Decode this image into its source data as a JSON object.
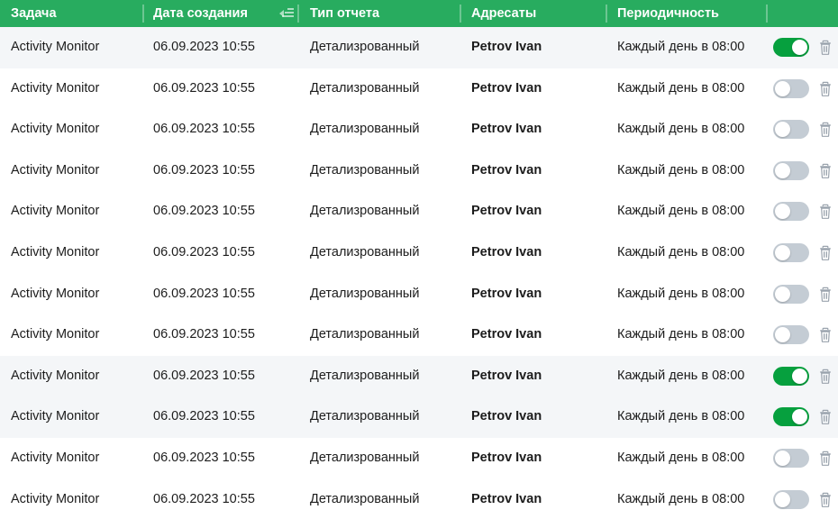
{
  "table": {
    "columns": [
      {
        "key": "task",
        "label": "Задача"
      },
      {
        "key": "date",
        "label": "Дата создания",
        "sort_icon": "sort-descending-icon"
      },
      {
        "key": "type",
        "label": "Тип отчета"
      },
      {
        "key": "addr",
        "label": "Адресаты"
      },
      {
        "key": "period",
        "label": "Периодичность"
      },
      {
        "key": "ctrl",
        "label": ""
      }
    ],
    "rows": [
      {
        "task": "Activity Monitor",
        "date": "06.09.2023 10:55",
        "type": "Детализрованный",
        "addr": "Petrov Ivan",
        "period": "Каждый день в 08:00",
        "enabled": true,
        "delete_icon": "trash-icon"
      },
      {
        "task": "Activity Monitor",
        "date": "06.09.2023 10:55",
        "type": "Детализрованный",
        "addr": "Petrov Ivan",
        "period": "Каждый день в 08:00",
        "enabled": false,
        "delete_icon": "trash-icon"
      },
      {
        "task": "Activity Monitor",
        "date": "06.09.2023 10:55",
        "type": "Детализрованный",
        "addr": "Petrov Ivan",
        "period": "Каждый день в 08:00",
        "enabled": false,
        "delete_icon": "trash-icon"
      },
      {
        "task": "Activity Monitor",
        "date": "06.09.2023 10:55",
        "type": "Детализрованный",
        "addr": "Petrov Ivan",
        "period": "Каждый день в 08:00",
        "enabled": false,
        "delete_icon": "trash-icon"
      },
      {
        "task": "Activity Monitor",
        "date": "06.09.2023 10:55",
        "type": "Детализрованный",
        "addr": "Petrov Ivan",
        "period": "Каждый день в 08:00",
        "enabled": false,
        "delete_icon": "trash-icon"
      },
      {
        "task": "Activity Monitor",
        "date": "06.09.2023 10:55",
        "type": "Детализрованный",
        "addr": "Petrov Ivan",
        "period": "Каждый день в 08:00",
        "enabled": false,
        "delete_icon": "trash-icon"
      },
      {
        "task": "Activity Monitor",
        "date": "06.09.2023 10:55",
        "type": "Детализрованный",
        "addr": "Petrov Ivan",
        "period": "Каждый день в 08:00",
        "enabled": false,
        "delete_icon": "trash-icon"
      },
      {
        "task": "Activity Monitor",
        "date": "06.09.2023 10:55",
        "type": "Детализрованный",
        "addr": "Petrov Ivan",
        "period": "Каждый день в 08:00",
        "enabled": false,
        "delete_icon": "trash-icon"
      },
      {
        "task": "Activity Monitor",
        "date": "06.09.2023 10:55",
        "type": "Детализрованный",
        "addr": "Petrov Ivan",
        "period": "Каждый день в 08:00",
        "enabled": true,
        "delete_icon": "trash-icon"
      },
      {
        "task": "Activity Monitor",
        "date": "06.09.2023 10:55",
        "type": "Детализрованный",
        "addr": "Petrov Ivan",
        "period": "Каждый день в 08:00",
        "enabled": true,
        "delete_icon": "trash-icon"
      },
      {
        "task": "Activity Monitor",
        "date": "06.09.2023 10:55",
        "type": "Детализрованный",
        "addr": "Petrov Ivan",
        "period": "Каждый день в 08:00",
        "enabled": false,
        "delete_icon": "trash-icon"
      },
      {
        "task": "Activity Monitor",
        "date": "06.09.2023 10:55",
        "type": "Детализрованный",
        "addr": "Petrov Ivan",
        "period": "Каждый день в 08:00",
        "enabled": false,
        "delete_icon": "trash-icon"
      }
    ]
  },
  "colors": {
    "header_green": "#28ac5f",
    "toggle_on": "#06a03e",
    "toggle_off": "#c4ccd4",
    "row_highlight": "#f4f6f8",
    "text": "#1c1c1c"
  }
}
